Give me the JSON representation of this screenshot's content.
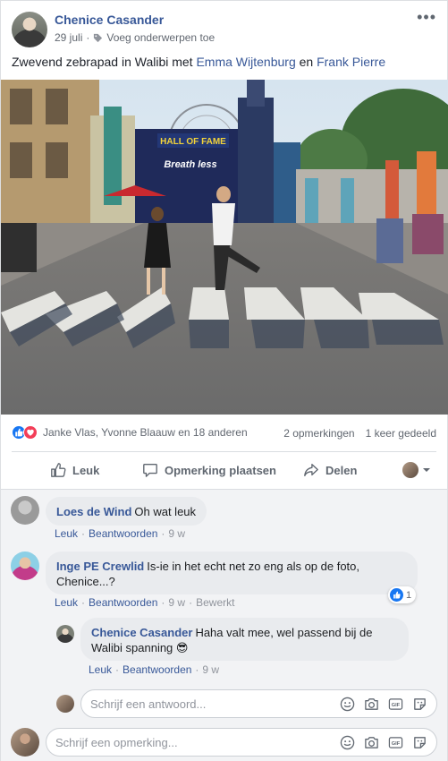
{
  "post": {
    "author": "Chenice Casander",
    "date": "29 juli",
    "tag_prompt": "Voeg onderwerpen toe",
    "caption_text": "Zwevend zebrapad in Walibi met ",
    "caption_tag1": "Emma Wijtenburg",
    "caption_and": " en ",
    "caption_tag2": "Frank Pierre",
    "photo_sign": "HALL OF FAME",
    "photo_logo": "Breath less"
  },
  "stats": {
    "reaction_names": "Janke Vlas, Yvonne Blaauw en 18 anderen",
    "comments": "2 opmerkingen",
    "shares": "1 keer gedeeld"
  },
  "actions": {
    "like": "Leuk",
    "comment": "Opmerking plaatsen",
    "share": "Delen"
  },
  "comments": [
    {
      "name": "Loes de Wind",
      "text": "Oh wat leuk",
      "like": "Leuk",
      "reply": "Beantwoorden",
      "time": "9 w"
    },
    {
      "name": "Inge PE Crewlid",
      "text_line1": "Is-ie in het echt net zo eng als op de foto,",
      "text_line2": "Chenice...?",
      "like": "Leuk",
      "reply": "Beantwoorden",
      "time": "9 w",
      "edited": "Bewerkt",
      "like_count": "1"
    }
  ],
  "reply": {
    "name": "Chenice Casander",
    "text_line1": "Haha valt mee, wel passend bij de",
    "text_line2": "Walibi spanning 😎",
    "like": "Leuk",
    "reply": "Beantwoorden",
    "time": "9 w"
  },
  "reply_input": {
    "placeholder": "Schrijf een antwoord..."
  },
  "comment_input": {
    "placeholder": "Schrijf een opmerking..."
  },
  "gif_label": "GIF",
  "colors": {
    "link": "#385898",
    "like_blue": "#1877f2",
    "love_red": "#f33e58"
  }
}
